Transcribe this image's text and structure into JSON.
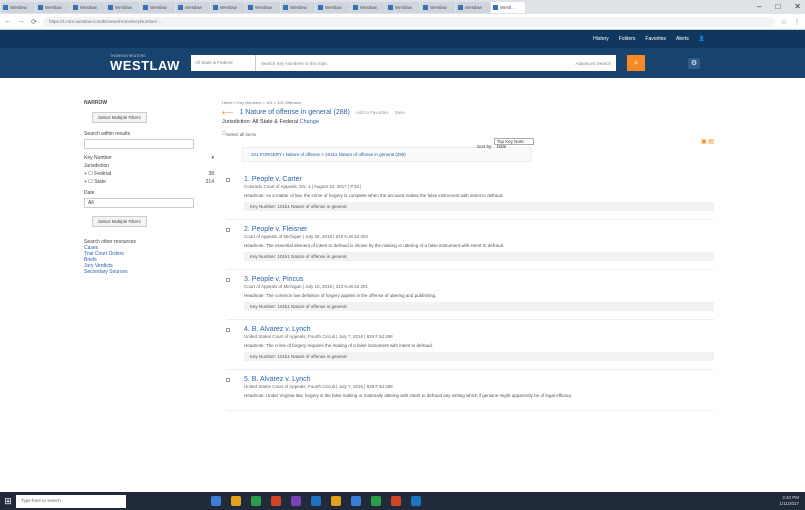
{
  "browser": {
    "tabs": [
      {
        "label": "Westlaw"
      },
      {
        "label": "Westlaw"
      },
      {
        "label": "Westlaw"
      },
      {
        "label": "Westlaw"
      },
      {
        "label": "Westlaw"
      },
      {
        "label": "Westlaw"
      },
      {
        "label": "Westlaw"
      },
      {
        "label": "Westlaw"
      },
      {
        "label": "Westlaw"
      },
      {
        "label": "Westlaw"
      },
      {
        "label": "Westlaw"
      },
      {
        "label": "Westlaw"
      },
      {
        "label": "Westlaw"
      },
      {
        "label": "Westlaw"
      },
      {
        "label": "Westl..."
      }
    ],
    "url": "https://1.next.westlaw.com/Browse/Home/KeyNumber/..."
  },
  "header": {
    "items": [
      "History",
      "Folders",
      "Favorites",
      "Alerts"
    ]
  },
  "toolbar": {
    "brand_top": "THOMSON REUTERS",
    "brand": "WESTLAW",
    "jurisdiction": "All State & Federal",
    "search_placeholder": "Search Key Numbers in this topic",
    "advanced": "Advanced Search"
  },
  "sidebar": {
    "narrow": "NARROW",
    "select_multiple": "Select Multiple Filters",
    "search_within": "Search within results",
    "key_number": "Key Number",
    "jurisdiction": "Jurisdiction",
    "federal": "Federal",
    "federal_count": "38",
    "state": "State",
    "state_count": "214",
    "date": "Date",
    "date_value": "All",
    "select_filters": "Select Multiple Filters",
    "search_other": "Search other resources",
    "other_links": [
      "Cases",
      "Trial Court Orders",
      "Briefs",
      "Jury Verdicts",
      "Secondary Sources"
    ]
  },
  "main": {
    "breadcrumb": "Home > Key Numbers > 101 > 101 Offenses",
    "title": "1 Nature of offense in general (288)",
    "add_fav": "Add to Favorites",
    "save": "Save",
    "jurisdiction_line": "Jurisdiction: All State & Federal",
    "change": "Change",
    "select_all": "Select all items",
    "sort_label": "Sort by:",
    "sort_value": "Top Key Note Date",
    "keynote": "101 FORGERY I Nature of offense > 101k1 Nature of offense in general (288)"
  },
  "results": [
    {
      "n": "1.",
      "title": "People v. Carter",
      "meta": "Colorado Court of Appeals, Div. 1 | August 10, 2017 | P.3d |",
      "headnote": "Headnote: As a matter of law, the crime of forgery is complete when the accused makes the false instrument with intent to defraud.",
      "kc": "Key Number: 101k1 Nature of offense in general"
    },
    {
      "n": "2.",
      "title": "People v. Fleisner",
      "meta": "Court of Appeals of Michigan | July 26, 2018 | 818 N.W.2d 403",
      "headnote": "Headnote: The essential element of intent to defraud is shown by the making or uttering of a false instrument with intent to defraud.",
      "kc": "Key Number: 101k1 Nature of offense in general"
    },
    {
      "n": "3.",
      "title": "People v. Pincus",
      "meta": "Court of Appeals of Michigan | July 10, 2015 | 313 N.W.2d 401",
      "headnote": "Headnote: The common law definition of forgery applies in the offense of uttering and publishing.",
      "kc": "Key Number: 101k1 Nature of offense in general"
    },
    {
      "n": "4.",
      "title": "B. Alvarez v. Lynch",
      "meta": "United States Court of Appeals, Fourth Circuit | July 7, 2016 | 828 F.3d 288",
      "headnote": "Headnote: The crime of forgery requires the making of a false instrument with intent to defraud.",
      "kc": "Key Number: 101k1 Nature of offense in general"
    },
    {
      "n": "5.",
      "title": "B. Alvarez v. Lynch",
      "meta": "United States Court of Appeals, Fourth Circuit | July 7, 2016 | 828 F.3d 288",
      "headnote": "Headnote: Under Virginia law, forgery is the false making or materially altering with intent to defraud any writing which if genuine might apparently be of legal efficacy.",
      "kc": ""
    }
  ],
  "taskbar": {
    "search": "Type here to search",
    "time": "3:40 PM",
    "date": "1/11/2017"
  }
}
